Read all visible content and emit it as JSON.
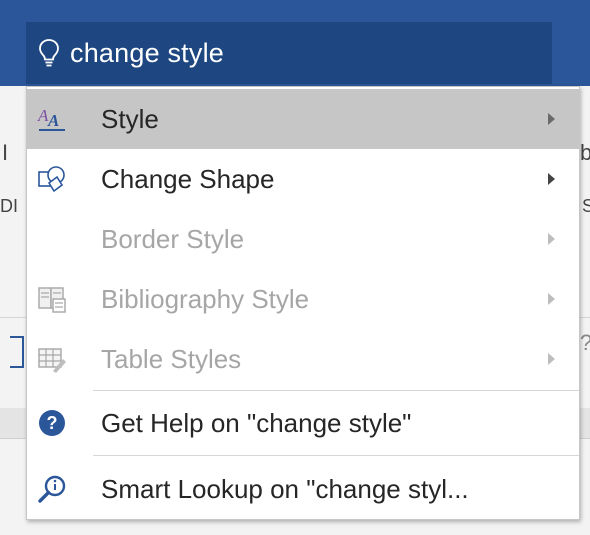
{
  "search": {
    "query": "change style",
    "icon": "lightbulb-icon"
  },
  "background": {
    "left_peek": "I",
    "left_peek2": "DI",
    "right_peek": "b",
    "right_peek2": "S",
    "left_box_peek": "[",
    "right_peek3": "?"
  },
  "menu": {
    "items": [
      {
        "label": "Style",
        "icon": "style-a-icon",
        "submenu": true,
        "state": "hovered"
      },
      {
        "label": "Change Shape",
        "icon": "change-shape-icon",
        "submenu": true,
        "state": "enabled"
      },
      {
        "label": "Border Style",
        "icon": "",
        "submenu": true,
        "state": "disabled"
      },
      {
        "label": "Bibliography Style",
        "icon": "bibliography-icon",
        "submenu": true,
        "state": "disabled"
      },
      {
        "label": "Table Styles",
        "icon": "table-styles-icon",
        "submenu": true,
        "state": "disabled"
      },
      {
        "label": "Get Help on \"change style\"",
        "icon": "help-icon",
        "submenu": false,
        "state": "enabled"
      },
      {
        "label": "Smart Lookup on \"change styl...",
        "icon": "smart-lookup-icon",
        "submenu": false,
        "state": "enabled"
      }
    ]
  },
  "colors": {
    "title_bar": "#2b579a",
    "search_box": "#1e4781",
    "hover": "#c6c6c6",
    "help_icon": "#2b579a",
    "disabled_text": "#a6a6a6"
  }
}
